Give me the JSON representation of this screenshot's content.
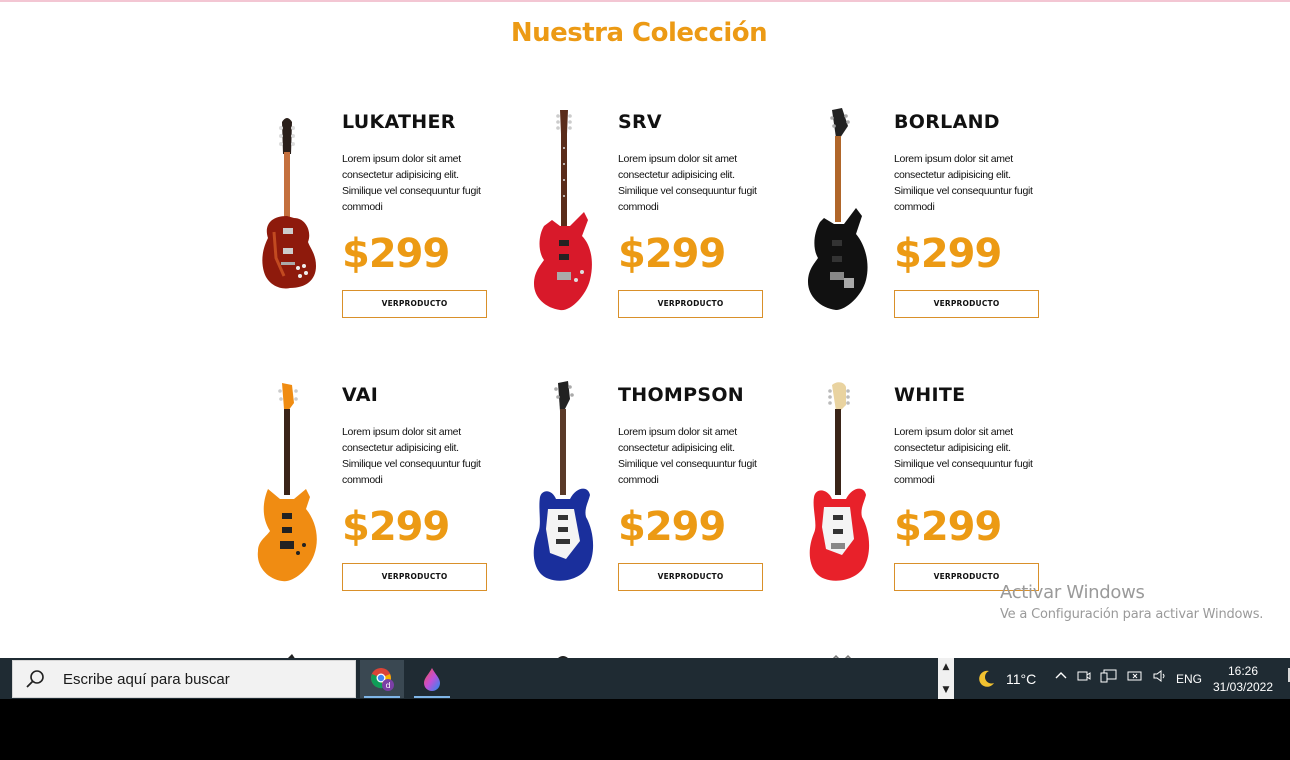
{
  "section": {
    "title": "Nuestra Colección"
  },
  "products": [
    {
      "name": "LUKATHER",
      "description": "Lorem ipsum dolor sit amet consectetur adipisicing elit. Similique vel consequuntur fugit commodi",
      "price": "$299",
      "button_label": "VERPRODUCTO",
      "body_color": "#8e1a0c",
      "guitar_type": "les-paul"
    },
    {
      "name": "SRV",
      "description": "Lorem ipsum dolor sit amet consectetur adipisicing elit. Similique vel consequuntur fugit commodi",
      "price": "$299",
      "button_label": "VERPRODUCTO",
      "body_color": "#d8192a",
      "guitar_type": "superstrat"
    },
    {
      "name": "BORLAND",
      "description": "Lorem ipsum dolor sit amet consectetur adipisicing elit. Similique vel consequuntur fugit commodi",
      "price": "$299",
      "button_label": "VERPRODUCTO",
      "body_color": "#111111",
      "guitar_type": "superstrat"
    },
    {
      "name": "VAI",
      "description": "Lorem ipsum dolor sit amet consectetur adipisicing elit. Similique vel consequuntur fugit commodi",
      "price": "$299",
      "button_label": "VERPRODUCTO",
      "body_color": "#f08c12",
      "guitar_type": "superstrat"
    },
    {
      "name": "THOMPSON",
      "description": "Lorem ipsum dolor sit amet consectetur adipisicing elit. Similique vel consequuntur fugit commodi",
      "price": "$299",
      "button_label": "VERPRODUCTO",
      "body_color": "#1a2f9c",
      "guitar_type": "strat"
    },
    {
      "name": "WHITE",
      "description": "Lorem ipsum dolor sit amet consectetur adipisicing elit. Similique vel consequuntur fugit commodi",
      "price": "$299",
      "button_label": "VERPRODUCTO",
      "body_color": "#e8212a",
      "guitar_type": "strat"
    }
  ],
  "watermark": {
    "title": "Activar Windows",
    "subtitle": "Ve a Configuración para activar Windows."
  },
  "taskbar": {
    "search_placeholder": "Escribe aquí para buscar",
    "apps": [
      {
        "icon": "chrome-icon",
        "active": true
      },
      {
        "icon": "paint-drop-icon",
        "active": false
      }
    ],
    "weather": {
      "icon": "moon-icon",
      "temperature": "11°C"
    },
    "language": "ENG",
    "time": "16:26",
    "date": "31/03/2022"
  },
  "colors": {
    "accent": "#ec9a14",
    "taskbar": "#1f2b33"
  }
}
